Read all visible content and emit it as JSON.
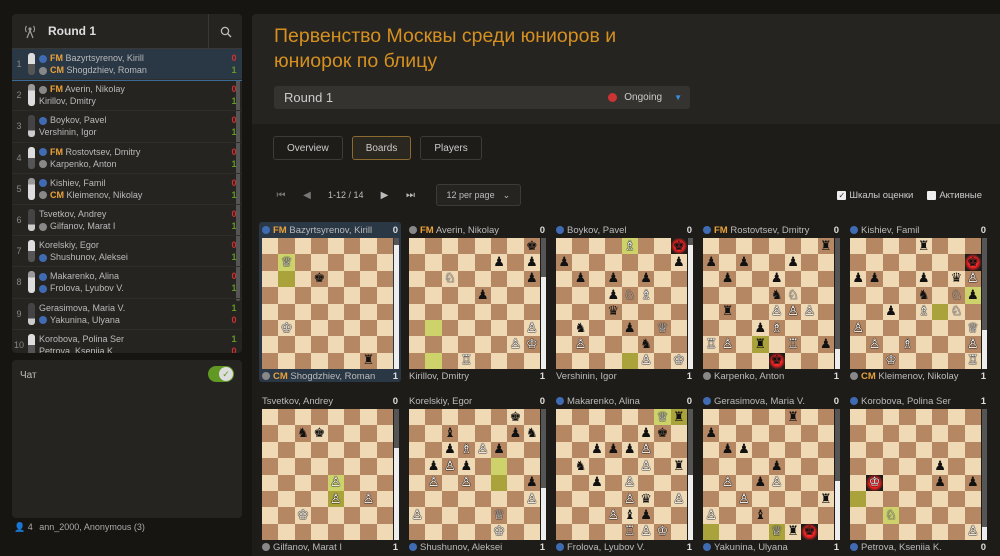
{
  "sidebar": {
    "round": "Round 1",
    "games": [
      {
        "n": "1",
        "w": {
          "title": "FM",
          "name": "Bazyrtsyrenov, Kirill",
          "flag": "fide",
          "r": "0"
        },
        "b": {
          "title": "CM",
          "name": "Shogdzhiev, Roman",
          "flag": "gray",
          "r": "1"
        }
      },
      {
        "n": "2",
        "w": {
          "title": "FM",
          "name": "Averin, Nikolay",
          "flag": "gray",
          "r": "0"
        },
        "b": {
          "title": "",
          "name": "Kirillov, Dmitry",
          "flag": "",
          "r": "1"
        }
      },
      {
        "n": "3",
        "w": {
          "title": "",
          "name": "Boykov, Pavel",
          "flag": "fide",
          "r": "0"
        },
        "b": {
          "title": "",
          "name": "Vershinin, Igor",
          "flag": "",
          "r": "1"
        }
      },
      {
        "n": "4",
        "w": {
          "title": "FM",
          "name": "Rostovtsev, Dmitry",
          "flag": "fide",
          "r": "0"
        },
        "b": {
          "title": "",
          "name": "Karpenko, Anton",
          "flag": "gray",
          "r": "1"
        }
      },
      {
        "n": "5",
        "w": {
          "title": "",
          "name": "Kishiev, Famil",
          "flag": "fide",
          "r": "0"
        },
        "b": {
          "title": "CM",
          "name": "Kleimenov, Nikolay",
          "flag": "gray",
          "r": "1"
        }
      },
      {
        "n": "6",
        "w": {
          "title": "",
          "name": "Tsvetkov, Andrey",
          "flag": "",
          "r": "0"
        },
        "b": {
          "title": "",
          "name": "Gilfanov, Marat I",
          "flag": "gray",
          "r": "1"
        }
      },
      {
        "n": "7",
        "w": {
          "title": "",
          "name": "Korelskiy, Egor",
          "flag": "",
          "r": "0"
        },
        "b": {
          "title": "",
          "name": "Shushunov, Aleksei",
          "flag": "fide",
          "r": "1"
        }
      },
      {
        "n": "8",
        "w": {
          "title": "",
          "name": "Makarenko, Alina",
          "flag": "fide",
          "r": "0"
        },
        "b": {
          "title": "",
          "name": "Frolova, Lyubov V.",
          "flag": "fide",
          "r": "1"
        }
      },
      {
        "n": "9",
        "w": {
          "title": "",
          "name": "Gerasimova, Maria V.",
          "flag": "",
          "r": "1"
        },
        "b": {
          "title": "",
          "name": "Yakunina, Ulyana",
          "flag": "fide",
          "r": "0"
        }
      },
      {
        "n": "10",
        "w": {
          "title": "",
          "name": "Korobova, Polina Ser",
          "flag": "",
          "r": "1"
        },
        "b": {
          "title": "",
          "name": "Petrova, Ksenija K.",
          "flag": "",
          "r": "0"
        }
      }
    ],
    "chat_label": "Чат",
    "spectators": "4",
    "spectator_names": "ann_2000, Anonymous (3)"
  },
  "main": {
    "title": "Первенство Москвы среди юниоров и юниорок по блицу",
    "round_select": "Round 1",
    "status": "Ongoing",
    "tabs": [
      "Overview",
      "Boards",
      "Players"
    ],
    "pager": "1-12 / 14",
    "per_page": "12 per page",
    "opt_eval": "Шкалы оценки",
    "opt_active": "Активные"
  },
  "colors": {
    "accent": "#d59020",
    "brand_blue": "#3a8de0",
    "loss": "#cc3333",
    "win": "#629924"
  },
  "boards": [
    {
      "top": {
        "flag": "fide",
        "title": "FM",
        "name": "Bazyrtsyrenov, Kirill",
        "score": "0"
      },
      "bot": {
        "flag": "gray",
        "title": "CM",
        "name": "Shogdzhiev, Roman",
        "score": "1"
      },
      "eval": 0.05,
      "hl": [
        [
          1,
          1
        ],
        [
          2,
          1
        ]
      ],
      "chk": [],
      "fen": "8/1Q6/3k4/8/8/1K6/8/6r1"
    },
    {
      "top": {
        "flag": "gray",
        "title": "FM",
        "name": "Averin, Nikolay",
        "score": "0"
      },
      "bot": {
        "flag": "",
        "title": "",
        "name": "Kirillov, Dmitry",
        "score": "1"
      },
      "eval": 0.3,
      "hl": [
        [
          5,
          1
        ],
        [
          7,
          1
        ]
      ],
      "chk": [],
      "fen": "7k/5p1p/2N4p/4p3/8/7P/6PK/3R4"
    },
    {
      "top": {
        "flag": "fide",
        "title": "",
        "name": "Boykov, Pavel",
        "score": "0"
      },
      "bot": {
        "flag": "",
        "title": "",
        "name": "Vershinin, Igor",
        "score": "1"
      },
      "eval": 0.05,
      "hl": [
        [
          0,
          4
        ],
        [
          7,
          4
        ]
      ],
      "chk": [
        [
          0,
          7
        ]
      ],
      "fen": "4B2k/p6p/1p1p1p2/3pNB2/3q4/1n2p1Q1/1P3n2/5P1K"
    },
    {
      "top": {
        "flag": "fide",
        "title": "FM",
        "name": "Rostovtsev, Dmitry",
        "score": "0"
      },
      "bot": {
        "flag": "gray",
        "title": "",
        "name": "Karpenko, Anton",
        "score": "1"
      },
      "eval": 0.85,
      "hl": [
        [
          6,
          3
        ]
      ],
      "chk": [
        [
          7,
          4
        ]
      ],
      "fen": "7r/p1p2p2/1p2p3/4nN2/1r2PPP1/3pB3/RP1r1R1p/4k3"
    },
    {
      "top": {
        "flag": "fide",
        "title": "",
        "name": "Kishiev, Famil",
        "score": "0"
      },
      "bot": {
        "flag": "gray",
        "title": "CM",
        "name": "Kleimenov, Nikolay",
        "score": "1"
      },
      "eval": 0.7,
      "hl": [
        [
          4,
          5
        ],
        [
          3,
          7
        ]
      ],
      "chk": [
        [
          1,
          7
        ]
      ],
      "fen": "4r3/7k/pp2p1qP/4n1Np/2p1B1N1/P6Q/1P1B3P/2K4R"
    },
    {
      "top": {
        "flag": "",
        "title": "",
        "name": "Tsvetkov, Andrey",
        "score": "0"
      },
      "bot": {
        "flag": "gray",
        "title": "",
        "name": "Gilfanov, Marat I",
        "score": "1"
      },
      "eval": 0.3,
      "hl": [
        [
          4,
          4
        ],
        [
          5,
          4
        ]
      ],
      "chk": [],
      "fen": "8/2nk4/8/8/4P3/4P1P1/2K5/8"
    },
    {
      "top": {
        "flag": "",
        "title": "",
        "name": "Korelskiy, Egor",
        "score": "0"
      },
      "bot": {
        "flag": "fide",
        "title": "",
        "name": "Shushunov, Aleksei",
        "score": "1"
      },
      "eval": 0.6,
      "hl": [
        [
          3,
          5
        ],
        [
          4,
          5
        ]
      ],
      "chk": [],
      "fen": "6k1/2b3pn/2pBPp2/1pPp4/1P1P3p/7P/P4Q2/5K2"
    },
    {
      "top": {
        "flag": "fide",
        "title": "",
        "name": "Makarenko, Alina",
        "score": "0"
      },
      "bot": {
        "flag": "fide",
        "title": "",
        "name": "Frolova, Lyubov V.",
        "score": "1"
      },
      "eval": 0.5,
      "hl": [
        [
          0,
          6
        ],
        [
          0,
          7
        ]
      ],
      "chk": [],
      "fen": "6Qr/5pk1/2pppP2/1n3P1r/2p1P3/4Pq1P/3Pbp2/4RPK1"
    },
    {
      "top": {
        "flag": "fide",
        "title": "",
        "name": "Gerasimova, Maria V.",
        "score": "0"
      },
      "bot": {
        "flag": "fide",
        "title": "",
        "name": "Yakunina, Ulyana",
        "score": "1"
      },
      "eval": 0.55,
      "hl": [
        [
          7,
          0
        ],
        [
          7,
          4
        ]
      ],
      "chk": [
        [
          7,
          6
        ]
      ],
      "fen": "5r2/p7/1pp5/4p3/1P1pP3/2P4r/P2b4/4Qrk1"
    },
    {
      "top": {
        "flag": "fide",
        "title": "",
        "name": "Korobova, Polina Ser",
        "score": "1"
      },
      "bot": {
        "flag": "fide",
        "title": "",
        "name": "Petrova, Kseniia K.",
        "score": "0"
      },
      "eval": 0.9,
      "hl": [
        [
          5,
          0
        ],
        [
          6,
          2
        ]
      ],
      "chk": [
        [
          4,
          1
        ]
      ],
      "fen": "8/8/8/5p2/1K3p1p/8/2N5/7P"
    }
  ]
}
